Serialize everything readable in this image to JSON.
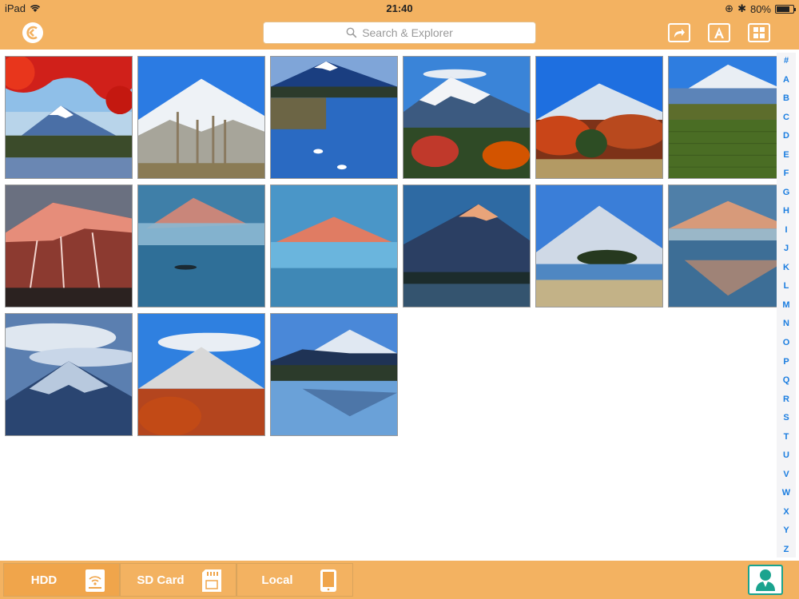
{
  "status_bar": {
    "device": "iPad",
    "time": "21:40",
    "battery": "80%",
    "battery_level": 0.8
  },
  "nav_bar": {
    "search_placeholder": "Search & Explorer",
    "icons": [
      "back-icon",
      "share-icon",
      "font-icon",
      "grid-view-icon"
    ]
  },
  "photos": [
    {
      "name": "fuji-autumn-maple"
    },
    {
      "name": "fuji-snow-trees"
    },
    {
      "name": "fuji-lake-blue"
    },
    {
      "name": "fuji-autumn-clouds"
    },
    {
      "name": "fuji-red-foliage"
    },
    {
      "name": "fuji-green-field"
    },
    {
      "name": "fuji-pink-dawn"
    },
    {
      "name": "fuji-misty-lake"
    },
    {
      "name": "fuji-pink-fog"
    },
    {
      "name": "fuji-sunset-peak"
    },
    {
      "name": "fuji-island-lake"
    },
    {
      "name": "fuji-reflection-dawn"
    },
    {
      "name": "fuji-cloud-cap"
    },
    {
      "name": "fuji-lenticular-autumn"
    },
    {
      "name": "fuji-reflection-blue"
    }
  ],
  "index_letters": [
    "#",
    "A",
    "B",
    "C",
    "D",
    "E",
    "F",
    "G",
    "H",
    "I",
    "J",
    "K",
    "L",
    "M",
    "N",
    "O",
    "P",
    "Q",
    "R",
    "S",
    "T",
    "U",
    "V",
    "W",
    "X",
    "Y",
    "Z"
  ],
  "bottom_tabs": [
    {
      "label": "HDD",
      "icon": "wifi-drive-icon",
      "active": true
    },
    {
      "label": "SD Card",
      "icon": "sd-card-icon",
      "active": false
    },
    {
      "label": "Local",
      "icon": "phone-icon",
      "active": false
    }
  ],
  "colors": {
    "accent": "#f3b261",
    "active_tab": "#f0a54b",
    "index_link": "#1a7de0",
    "account": "#1aa38e"
  }
}
